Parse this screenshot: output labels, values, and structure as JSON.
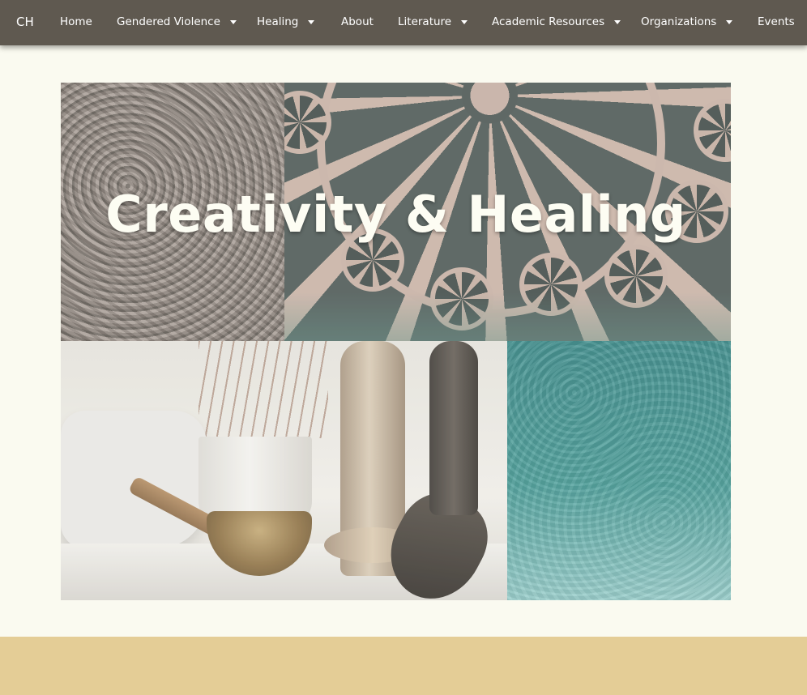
{
  "navbar": {
    "brand": "CH",
    "items": [
      {
        "label": "Home",
        "dropdown": false
      },
      {
        "label": "Gendered Violence",
        "dropdown": true
      },
      {
        "label": "Healing",
        "dropdown": true
      },
      {
        "label": "About",
        "dropdown": false
      },
      {
        "label": "Literature",
        "dropdown": true
      },
      {
        "label": "Academic Resources",
        "dropdown": true
      },
      {
        "label": "Organizations",
        "dropdown": true
      },
      {
        "label": "Events",
        "dropdown": false
      }
    ]
  },
  "hero": {
    "title": "Creativity & Healing",
    "images": [
      "rock-texture",
      "ornate-metal-grate",
      "singing-bowl-still-life",
      "teal-water"
    ]
  },
  "colors": {
    "navbar": "#5f5950",
    "page_background": "#fafaf0",
    "footer_band": "#e4cd96",
    "title_text": "#fdfdf3"
  }
}
